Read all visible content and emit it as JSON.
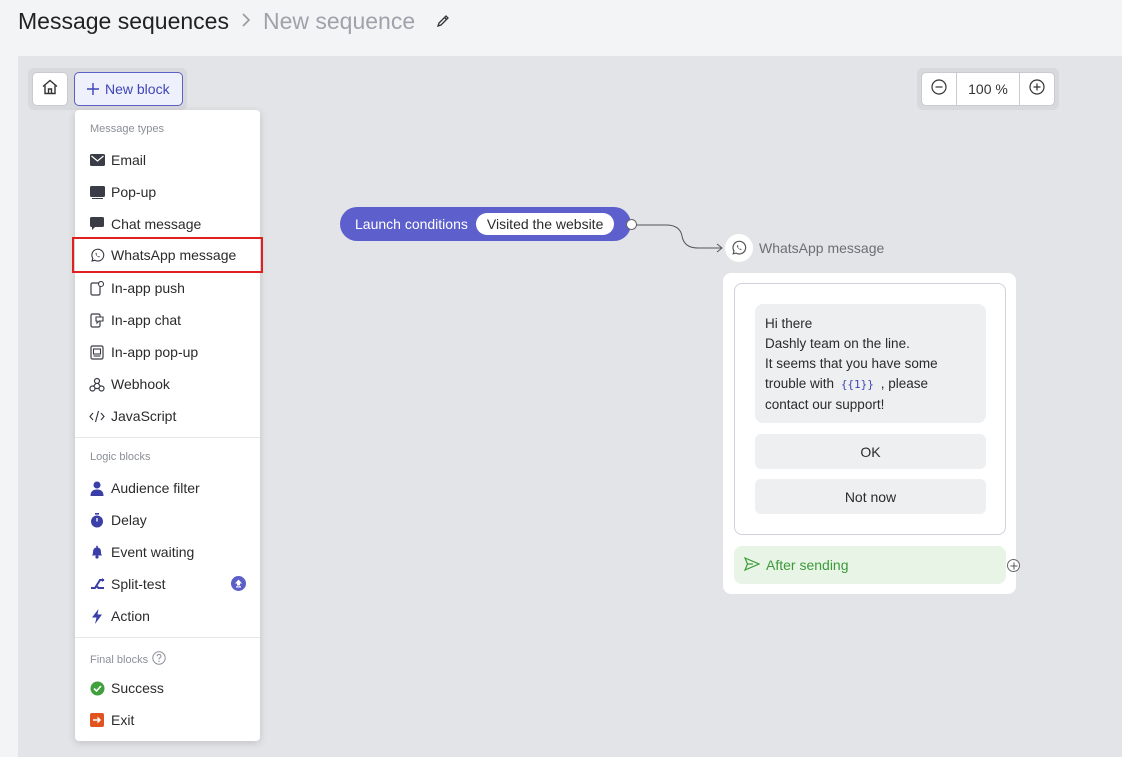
{
  "header": {
    "breadcrumb_parent": "Message sequences",
    "separator": ">",
    "current": "New sequence"
  },
  "toolbar": {
    "new_block_label": "New block",
    "zoom_value": "100 %"
  },
  "menu": {
    "message_types_title": "Message types",
    "message_types": [
      {
        "label": "Email",
        "icon": "envelope-icon"
      },
      {
        "label": "Pop-up",
        "icon": "popup-icon"
      },
      {
        "label": "Chat message",
        "icon": "chat-bubble-icon"
      },
      {
        "label": "WhatsApp message",
        "icon": "whatsapp-icon",
        "selected": true
      },
      {
        "label": "In-app push",
        "icon": "mobile-push-icon"
      },
      {
        "label": "In-app chat",
        "icon": "mobile-chat-icon"
      },
      {
        "label": "In-app pop-up",
        "icon": "mobile-popup-icon"
      },
      {
        "label": "Webhook",
        "icon": "webhook-icon"
      },
      {
        "label": "JavaScript",
        "icon": "code-icon"
      }
    ],
    "logic_blocks_title": "Logic blocks",
    "logic_blocks": [
      {
        "label": "Audience filter",
        "icon": "person-icon"
      },
      {
        "label": "Delay",
        "icon": "stopwatch-icon"
      },
      {
        "label": "Event waiting",
        "icon": "bell-icon"
      },
      {
        "label": "Split-test",
        "icon": "split-icon",
        "badge": "upgrade-icon"
      },
      {
        "label": "Action",
        "icon": "lightning-icon"
      }
    ],
    "final_blocks_title": "Final blocks",
    "final_blocks": [
      {
        "label": "Success",
        "icon": "check-circle-icon"
      },
      {
        "label": "Exit",
        "icon": "exit-icon"
      }
    ]
  },
  "flow": {
    "launch_label": "Launch conditions",
    "launch_condition": "Visited the website",
    "block_title": "WhatsApp message",
    "message_lines": {
      "line1": "Hi there",
      "line2": "Dashly team on the line.",
      "line3": "It seems that you have some",
      "line4_pre": "trouble with",
      "variable": "{{1}}",
      "line4_post": ", please",
      "line5": "contact our support!"
    },
    "quick_replies": [
      "OK",
      "Not now"
    ],
    "after_sending": "After sending"
  },
  "colors": {
    "accent": "#5c5fcc",
    "selection_outline": "#e02020",
    "success_text": "#3c9a3a",
    "success_bg": "#e8f5e6",
    "exit": "#e0541f"
  }
}
